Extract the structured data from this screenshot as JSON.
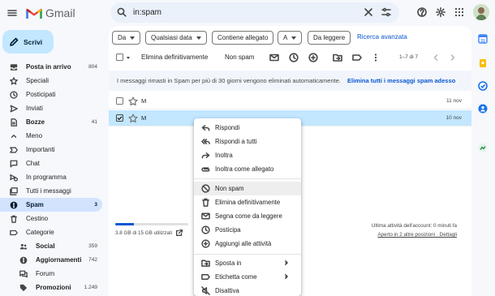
{
  "app": {
    "name": "Gmail"
  },
  "search": {
    "query": "in:spam"
  },
  "compose": {
    "label": "Scrivi"
  },
  "sidebar": {
    "items": [
      {
        "label": "Posta in arrivo",
        "count": "804",
        "bold": true
      },
      {
        "label": "Speciali",
        "count": ""
      },
      {
        "label": "Posticipati",
        "count": ""
      },
      {
        "label": "Inviati",
        "count": ""
      },
      {
        "label": "Bozze",
        "count": "41",
        "bold": true
      },
      {
        "label": "Meno",
        "count": ""
      },
      {
        "label": "Importanti",
        "count": ""
      },
      {
        "label": "Chat",
        "count": ""
      },
      {
        "label": "In programma",
        "count": ""
      },
      {
        "label": "Tutti i messaggi",
        "count": ""
      },
      {
        "label": "Spam",
        "count": "3",
        "active": true
      },
      {
        "label": "Cestino",
        "count": ""
      },
      {
        "label": "Categorie",
        "count": ""
      },
      {
        "label": "Social",
        "count": "359",
        "bold": true
      },
      {
        "label": "Aggiornamenti",
        "count": "742",
        "bold": true
      },
      {
        "label": "Forum",
        "count": ""
      },
      {
        "label": "Promozioni",
        "count": "1.249",
        "bold": true
      }
    ]
  },
  "filters": {
    "from": "Da",
    "any_time": "Qualsiasi data",
    "has_attachment": "Contiene allegato",
    "to": "A",
    "unread": "Da leggere",
    "advanced": "Ricerca avanzata"
  },
  "toolbar": {
    "delete_forever": "Elimina definitivamente",
    "not_spam": "Non spam",
    "range": "1–7 di 7"
  },
  "banner": {
    "text": "I messaggi rimasti in Spam per più di 30 giorni vengono eliminati automaticamente.",
    "link": "Elimina tutti i messaggi spam adesso"
  },
  "messages": [
    {
      "sender": "M",
      "date": "11 nov",
      "selected": false
    },
    {
      "sender": "M",
      "date": "10 nov",
      "selected": true
    }
  ],
  "footer": {
    "storage": "3.8 GB di 15 GB utilizzati",
    "storage_used_fraction": 0.25,
    "activity": "Ultima attività dell'account: 0 minuti fa",
    "open_in": "Aperto in 2 altre posizioni · Dettagli"
  },
  "context_menu": {
    "items": [
      {
        "label": "Rispondi",
        "icon": "reply-icon"
      },
      {
        "label": "Rispondi a tutti",
        "icon": "reply-all-icon"
      },
      {
        "label": "Inoltra",
        "icon": "forward-icon"
      },
      {
        "label": "Inoltra come allegato",
        "icon": "attachment-icon"
      },
      {
        "label": "Non spam",
        "icon": "not-spam-icon",
        "highlighted": true
      },
      {
        "label": "Elimina definitivamente",
        "icon": "trash-icon"
      },
      {
        "label": "Segna come da leggere",
        "icon": "mark-unread-icon"
      },
      {
        "label": "Posticipa",
        "icon": "clock-icon"
      },
      {
        "label": "Aggiungi alle attività",
        "icon": "add-task-icon"
      },
      {
        "label": "Sposta in",
        "icon": "move-icon",
        "submenu": true
      },
      {
        "label": "Etichetta come",
        "icon": "label-icon",
        "submenu": true
      },
      {
        "label": "Disattiva",
        "icon": "mute-icon"
      }
    ]
  },
  "colors": {
    "accent": "#0b57d0",
    "compose_bg": "#c2e7ff",
    "active_nav_bg": "#d3e3fd",
    "selected_row_bg": "#c2e7ff",
    "page_bg": "#f6f8fc"
  }
}
